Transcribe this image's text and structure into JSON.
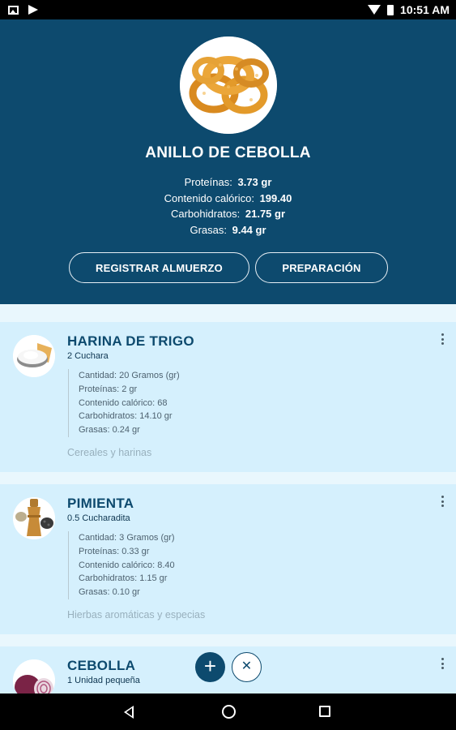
{
  "status_bar": {
    "time": "10:51 AM"
  },
  "recipe": {
    "title": "ANILLO DE CEBOLLA",
    "photo_icon": "onion-rings-photo",
    "nutrients": [
      {
        "label": "Proteínas:",
        "value": "3.73 gr"
      },
      {
        "label": "Contenido calórico:",
        "value": "199.40"
      },
      {
        "label": "Carbohidratos:",
        "value": "21.75 gr"
      },
      {
        "label": "Grasas:",
        "value": "9.44 gr"
      }
    ]
  },
  "buttons": {
    "register": "REGISTRAR ALMUERZO",
    "preparation": "PREPARACIÓN"
  },
  "ingredients": [
    {
      "name": "HARINA DE TRIGO",
      "portion": "2 Cuchara",
      "details": [
        "Cantidad: 20 Gramos (gr)",
        "Proteínas: 2 gr",
        "Contenido calórico: 68",
        "Carbohidratos: 14.10 gr",
        "Grasas: 0.24 gr"
      ],
      "category": "Cereales y harinas",
      "icon": "flour-icon"
    },
    {
      "name": "PIMIENTA",
      "portion": "0.5 Cucharadita",
      "details": [
        "Cantidad: 3 Gramos (gr)",
        "Proteínas: 0.33 gr",
        "Contenido calórico: 8.40",
        "Carbohidratos: 1.15 gr",
        "Grasas: 0.10 gr"
      ],
      "category": "Hierbas aromáticas y especias",
      "icon": "pepper-icon"
    },
    {
      "name": "CEBOLLA",
      "portion": "1 Unidad pequeña",
      "icon": "onion-icon"
    }
  ],
  "fab": {
    "add": "+",
    "close": "✕"
  },
  "colors": {
    "primary": "#0d4a6e",
    "card": "#d5f0fd",
    "background": "#e9f7fd"
  }
}
